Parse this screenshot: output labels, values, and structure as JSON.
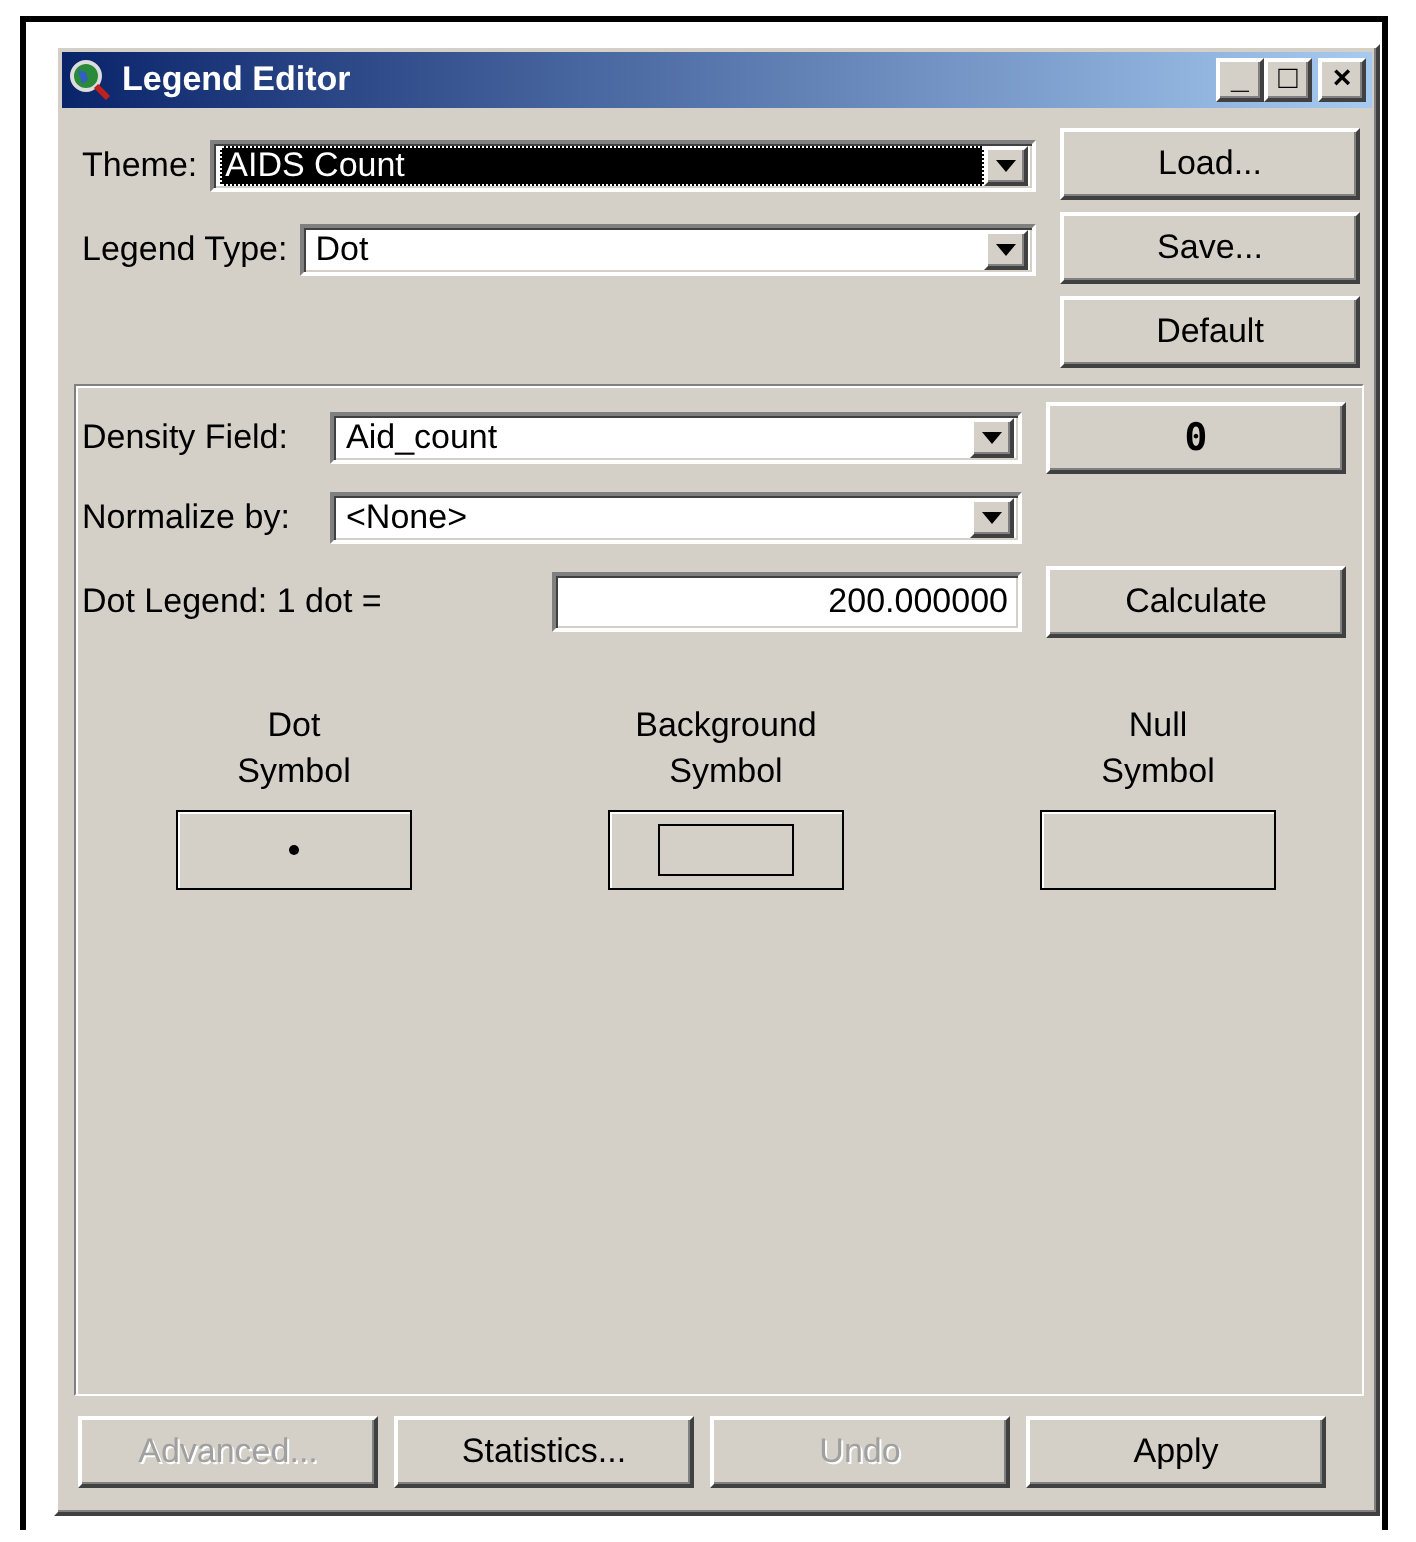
{
  "window": {
    "title": "Legend Editor",
    "controls": [
      "_",
      "□",
      "×"
    ]
  },
  "theme": {
    "label": "Theme:",
    "value": "AIDS Count",
    "focused": true
  },
  "legend_type": {
    "label": "Legend Type:",
    "value": "Dot"
  },
  "side_buttons": [
    {
      "label": "Load...",
      "disabled": false
    },
    {
      "label": "Save...",
      "disabled": false
    },
    {
      "label": "Default",
      "disabled": false
    }
  ],
  "density_field": {
    "label": "Density Field:",
    "value": "Aid_count"
  },
  "count_button": {
    "label": "0"
  },
  "normalize_by": {
    "label": "Normalize by:",
    "value": "<None>"
  },
  "dot_legend": {
    "label": "Dot Legend: 1 dot =",
    "value": "200.000000"
  },
  "calculate_button": {
    "label": "Calculate"
  },
  "symbols": [
    {
      "kind": "dot",
      "label": "Dot\nSymbol"
    },
    {
      "kind": "background",
      "label": "Background\nSymbol"
    },
    {
      "kind": "null",
      "label": "Null\nSymbol"
    }
  ],
  "bottom_buttons": [
    {
      "label": "Advanced...",
      "disabled": true
    },
    {
      "label": "Statistics...",
      "disabled": false
    },
    {
      "label": "Undo",
      "disabled": true
    },
    {
      "label": "Apply",
      "disabled": false
    }
  ]
}
